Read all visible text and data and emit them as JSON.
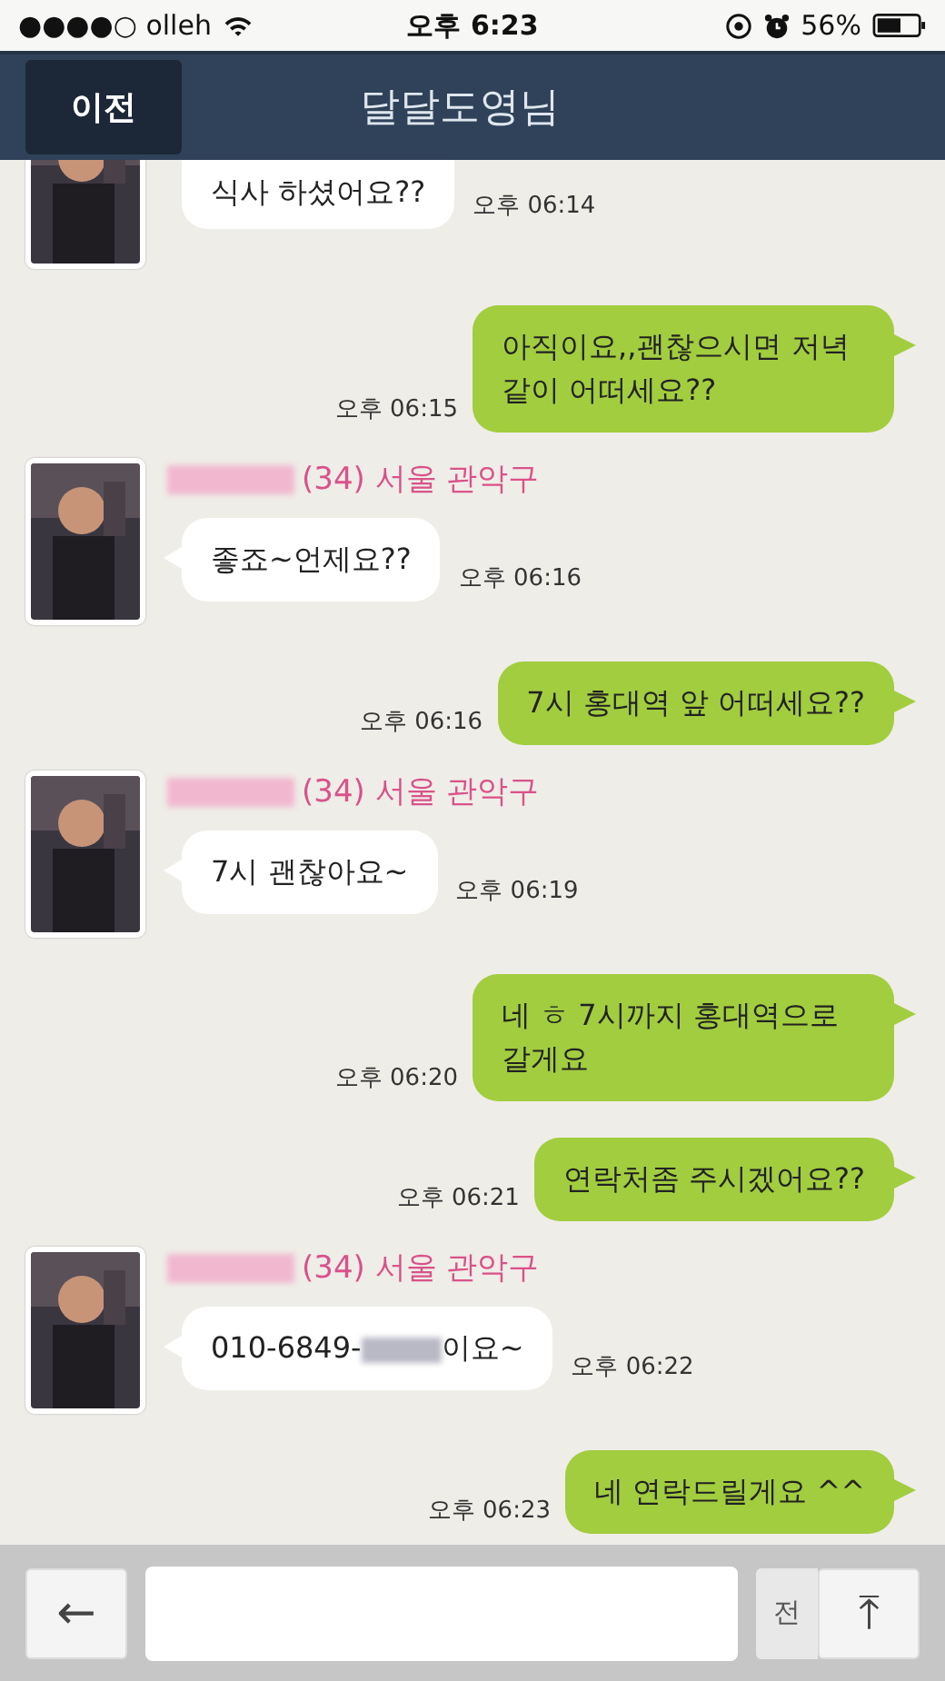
{
  "status_bar": {
    "carrier": "●●●●○ olleh",
    "time": "오후 6:23",
    "battery": "56%"
  },
  "header": {
    "back": "이전",
    "title": "달달도영님"
  },
  "messages": [
    {
      "kind": "received",
      "partial": true,
      "parts": [
        {
          "kind": "text",
          "text": "식사 하셨어요??"
        }
      ],
      "time": "오후 06:14"
    },
    {
      "kind": "sent",
      "parts": [
        {
          "kind": "text",
          "text": "아직이요,,괜찮으시면 저녁 같이 어떠세요??"
        }
      ],
      "time": "오후 06:15"
    },
    {
      "kind": "received",
      "name": [
        {
          "kind": "redacted"
        },
        {
          "kind": "text",
          "text": "(34) 서울 관악구"
        }
      ],
      "parts": [
        {
          "kind": "text",
          "text": "좋죠~언제요??"
        }
      ],
      "time": "오후 06:16"
    },
    {
      "kind": "sent",
      "parts": [
        {
          "kind": "text",
          "text": "7시 홍대역 앞 어떠세요??"
        }
      ],
      "time": "오후 06:16"
    },
    {
      "kind": "received",
      "name": [
        {
          "kind": "redacted"
        },
        {
          "kind": "text",
          "text": "(34) 서울 관악구"
        }
      ],
      "parts": [
        {
          "kind": "text",
          "text": "7시 괜찮아요~"
        }
      ],
      "time": "오후 06:19"
    },
    {
      "kind": "sent",
      "parts": [
        {
          "kind": "text",
          "text": "네 ㅎ 7시까지 홍대역으로 갈게요"
        }
      ],
      "time": "오후 06:20"
    },
    {
      "kind": "sent",
      "parts": [
        {
          "kind": "text",
          "text": "연락처좀 주시겠어요??"
        }
      ],
      "time": "오후 06:21"
    },
    {
      "kind": "received",
      "name": [
        {
          "kind": "redacted"
        },
        {
          "kind": "text",
          "text": "(34) 서울 관악구"
        }
      ],
      "parts": [
        {
          "kind": "text",
          "text": "010-6849-"
        },
        {
          "kind": "redacted"
        },
        {
          "kind": "text",
          "text": "이요~"
        }
      ],
      "time": "오후 06:22"
    },
    {
      "kind": "sent",
      "parts": [
        {
          "kind": "text",
          "text": "네 연락드릴게요 ^^"
        }
      ],
      "time": "오후 06:23"
    }
  ],
  "input_bar": {
    "back_key": "←",
    "send_partial": "전",
    "top_key": "⤒"
  }
}
